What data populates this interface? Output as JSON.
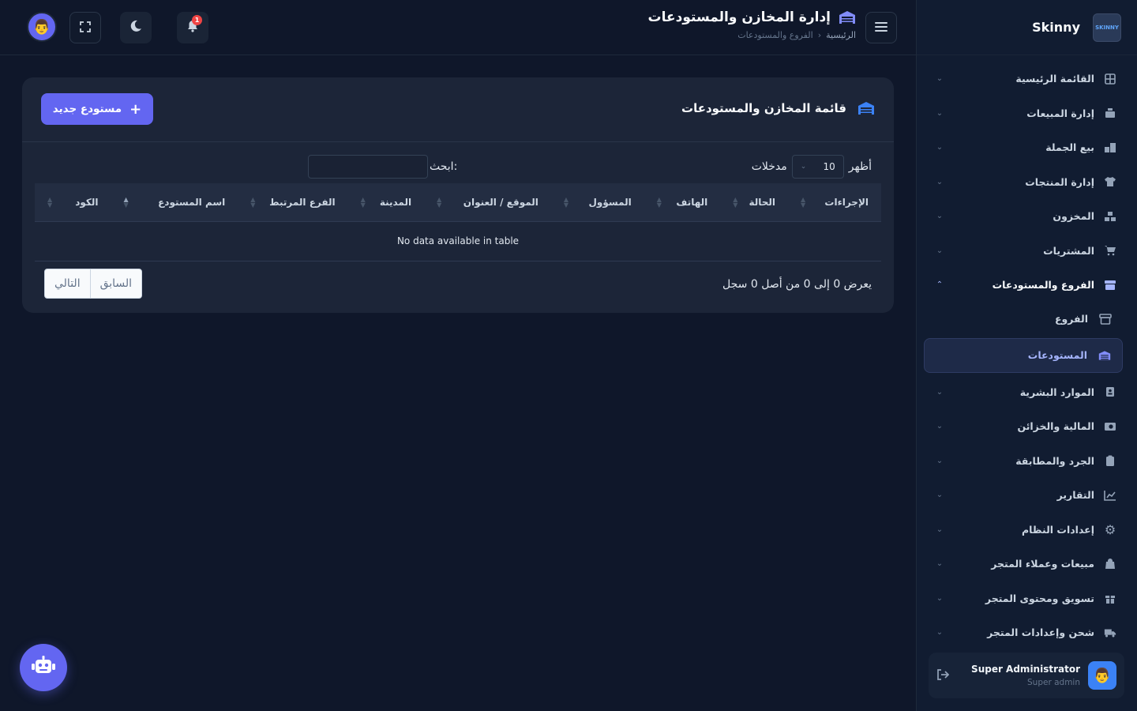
{
  "sidebar": {
    "brand": "Skinny",
    "logo_text": "SKINNY",
    "items": [
      {
        "label": "القائمة الرئيسية",
        "icon": "grid-icon"
      },
      {
        "label": "إدارة المبيعات",
        "icon": "cash-register-icon"
      },
      {
        "label": "بيع الجملة",
        "icon": "boxes-icon"
      },
      {
        "label": "إدارة المنتجات",
        "icon": "shirt-icon"
      },
      {
        "label": "المخزون",
        "icon": "cubes-icon"
      },
      {
        "label": "المشتريات",
        "icon": "cart-icon"
      },
      {
        "label": "الفروع والمستودعات",
        "icon": "store-icon"
      }
    ],
    "sub_items": [
      {
        "label": "الفروع",
        "icon": "store-icon"
      },
      {
        "label": "المستودعات",
        "icon": "warehouse-icon"
      }
    ],
    "items_after": [
      {
        "label": "الموارد البشرية",
        "icon": "id-badge-icon"
      },
      {
        "label": "المالية والخزائن",
        "icon": "money-icon"
      },
      {
        "label": "الجرد والمطابقة",
        "icon": "clipboard-icon"
      },
      {
        "label": "التقارير",
        "icon": "chart-line-icon"
      },
      {
        "label": "إعدادات النظام",
        "icon": "gear-icon"
      },
      {
        "label": "مبيعات وعملاء المتجر",
        "icon": "bag-icon"
      },
      {
        "label": "تسويق ومحتوى المتجر",
        "icon": "gift-icon"
      },
      {
        "label": "شحن وإعدادات المتجر",
        "icon": "truck-icon"
      }
    ],
    "user": {
      "name": "Super Administrator",
      "role": "Super admin"
    }
  },
  "header": {
    "title": "إدارة المخازن والمستودعات",
    "breadcrumb_home": "الرئيسية",
    "breadcrumb_sep": "›",
    "breadcrumb_current": "الفروع والمستودعات",
    "notification_count": "1"
  },
  "card": {
    "title": "قائمة المخازن والمستودعات",
    "new_button": "مستودع جديد",
    "show_label": "أظهر",
    "entries_label": "مدخلات",
    "page_length": "10",
    "search_label": "ابحث:",
    "search_value": "",
    "columns": [
      "الكود",
      "اسم المستودع",
      "الفرع المرتبط",
      "المدينة",
      "الموقع / العنوان",
      "المسؤول",
      "الهاتف",
      "الحالة",
      "الإجراءات"
    ],
    "sorted_column": "اسم المستودع",
    "empty_message": "No data available in table",
    "info": "يعرض 0 إلى 0 من أصل 0 سجل",
    "prev": "السابق",
    "next": "التالي"
  },
  "colors": {
    "accent": "#6366f1",
    "background": "#0f172a",
    "card": "#1c2538",
    "badge": "#ef4444"
  }
}
